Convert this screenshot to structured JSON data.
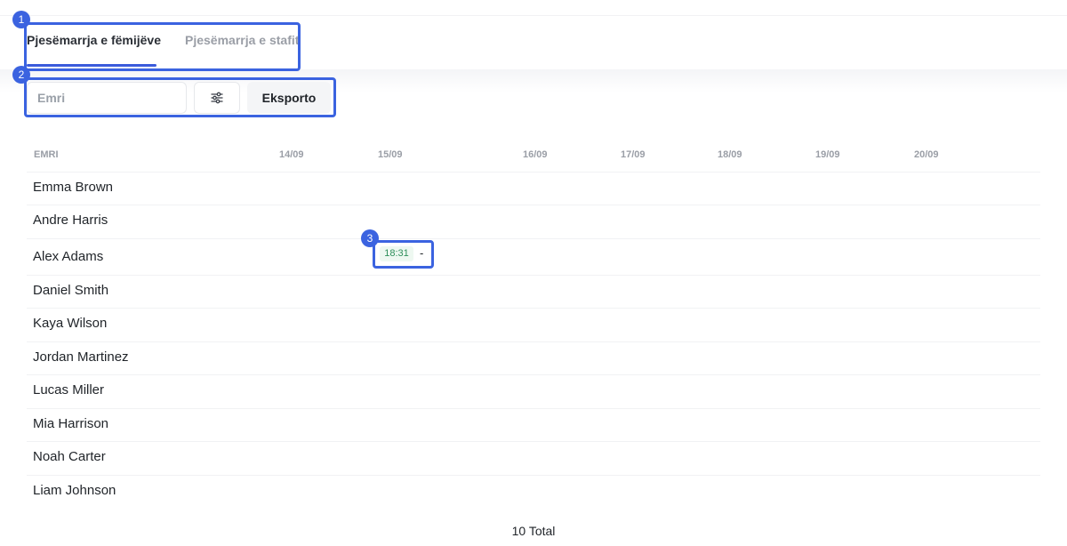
{
  "tabs": [
    {
      "label": "Pjesëmarrja e fëmijëve",
      "active": true
    },
    {
      "label": "Pjesëmarrja e stafit",
      "active": false
    }
  ],
  "toolbar": {
    "search_placeholder": "Emri",
    "filter_icon": "sliders-icon",
    "export_label": "Eksporto"
  },
  "table": {
    "columns": [
      "EMRI",
      "14/09",
      "15/09",
      "16/09",
      "17/09",
      "18/09",
      "19/09",
      "20/09"
    ],
    "rows": [
      {
        "name": "Emma Brown"
      },
      {
        "name": "Andre Harris"
      },
      {
        "name": "Alex Adams",
        "entries": [
          {
            "date": "15/09",
            "in": "18:31",
            "out": "-"
          }
        ]
      },
      {
        "name": "Daniel Smith"
      },
      {
        "name": "Kaya Wilson"
      },
      {
        "name": "Jordan Martinez"
      },
      {
        "name": "Lucas Miller"
      },
      {
        "name": "Mia Harrison"
      },
      {
        "name": "Noah Carter"
      },
      {
        "name": "Liam Johnson"
      }
    ]
  },
  "footer": {
    "total": "10 Total"
  },
  "annotations": [
    "1",
    "2",
    "3"
  ],
  "colors": {
    "accent": "#3b5bdb",
    "annotation": "#3b63e0",
    "time_in": "#2f8f5b"
  }
}
